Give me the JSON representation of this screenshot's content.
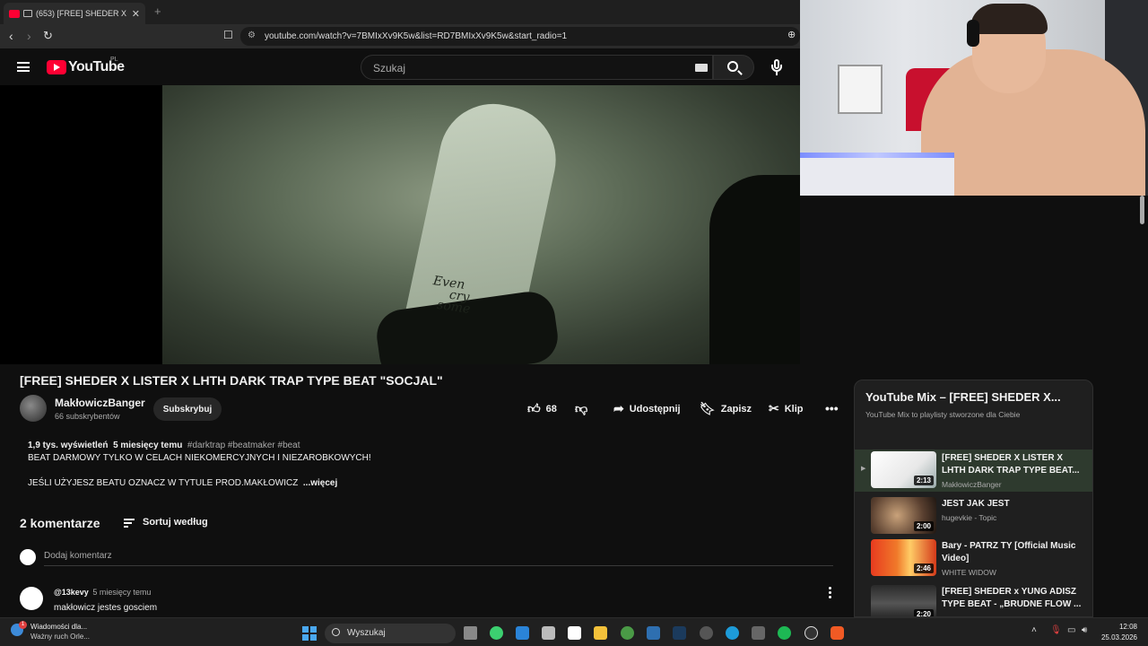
{
  "browser": {
    "tab_title": "(653) [FREE] SHEDER X LISTER X",
    "tab_close": "✕",
    "new_tab": "+",
    "url": "youtube.com/watch?v=7BMIxXv9K5w&list=RD7BMIxXv9K5w&start_radio=1"
  },
  "masthead": {
    "logo_text": "YouTube",
    "country": "PL",
    "search_placeholder": "Szukaj"
  },
  "video": {
    "wrist_text_1": "Even",
    "wrist_text_2": "cry",
    "wrist_text_3": "some"
  },
  "watch": {
    "title": "[FREE] SHEDER X LISTER X LHTH DARK TRAP TYPE BEAT \"SOCJAL\"",
    "channel_name": "MakłowiczBanger",
    "subscribers": "66 subskrybentów",
    "subscribe_label": "Subskrybuj",
    "like_count": "68",
    "share_label": "Udostępnij",
    "save_label": "Zapisz",
    "clip_label": "Klip"
  },
  "description": {
    "views": "1,9 tys. wyświetleń",
    "age": "5 miesięcy temu",
    "tags": "#darktrap #beatmaker #beat",
    "line1": "BEAT DARMOWY TYLKO W CELACH NIEKOMERCYJNYCH I NIEZAROBKOWYCH!",
    "line2": "JEŚLI UŻYJESZ BEATU OZNACZ W TYTULE PROD.MAKŁOWICZ",
    "more": "...więcej"
  },
  "comments": {
    "count_label": "2 komentarze",
    "sort_label": "Sortuj według",
    "add_placeholder": "Dodaj komentarz",
    "items": [
      {
        "user": "@13kevy",
        "time": "5 miesięcy temu",
        "text": "makłowicz jestes gosciem"
      }
    ]
  },
  "playlist": {
    "title": "YouTube Mix – [FREE] SHEDER X...",
    "subtitle": "YouTube Mix to playlisty stworzone dla Ciebie",
    "close": "✕",
    "items": [
      {
        "title": "[FREE] SHEDER X LISTER X LHTH DARK TRAP TYPE BEAT...",
        "channel": "MakłowiczBanger",
        "duration": "2:13"
      },
      {
        "title": "JEST JAK JEST",
        "channel": "hugevkie - Topic",
        "duration": "2:00"
      },
      {
        "title": "Bary - PATRZ TY [Official Music Video]",
        "channel": "WHITE WIDOW",
        "duration": "2:46"
      },
      {
        "title": "[FREE] SHEDER x YUNG ADISZ TYPE BEAT - „BRUDNE FLOW ...",
        "channel": "",
        "duration": "2:20"
      }
    ]
  },
  "taskbar": {
    "news_title": "Wiadomości dla...",
    "news_sub": "Ważny ruch Orle...",
    "badge": "1",
    "search_label": "Wyszukaj",
    "time": "12:08",
    "date": "25.03.2026"
  },
  "colors": {
    "accent": "#ff0033",
    "background": "#0f0f0f",
    "panel": "#1f1f1f"
  }
}
